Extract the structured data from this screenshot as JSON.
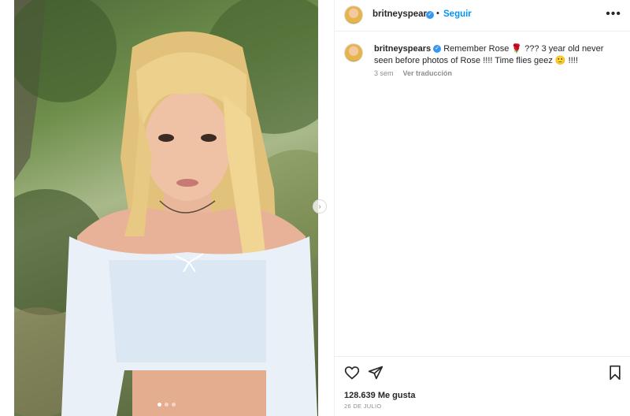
{
  "post": {
    "author": "britneyspears",
    "follow_label": "Seguir",
    "separator": "•",
    "more_icon": "more-horizontal-icon",
    "carousel": {
      "count": 3,
      "active": 0
    }
  },
  "caption": {
    "author": "britneyspears",
    "text": "Remember Rose 🌹 ??? 3 year old never seen before photos of Rose !!!! Time flies geez 🙂 !!!!",
    "time": "3 sem",
    "translate_label": "Ver traducción"
  },
  "stats": {
    "likes": "128.639 Me gusta",
    "date": "26 DE JULIO"
  },
  "colors": {
    "link": "#0095f6",
    "verified": "#3897f0",
    "text": "#262626",
    "muted": "#8e8e8e"
  }
}
